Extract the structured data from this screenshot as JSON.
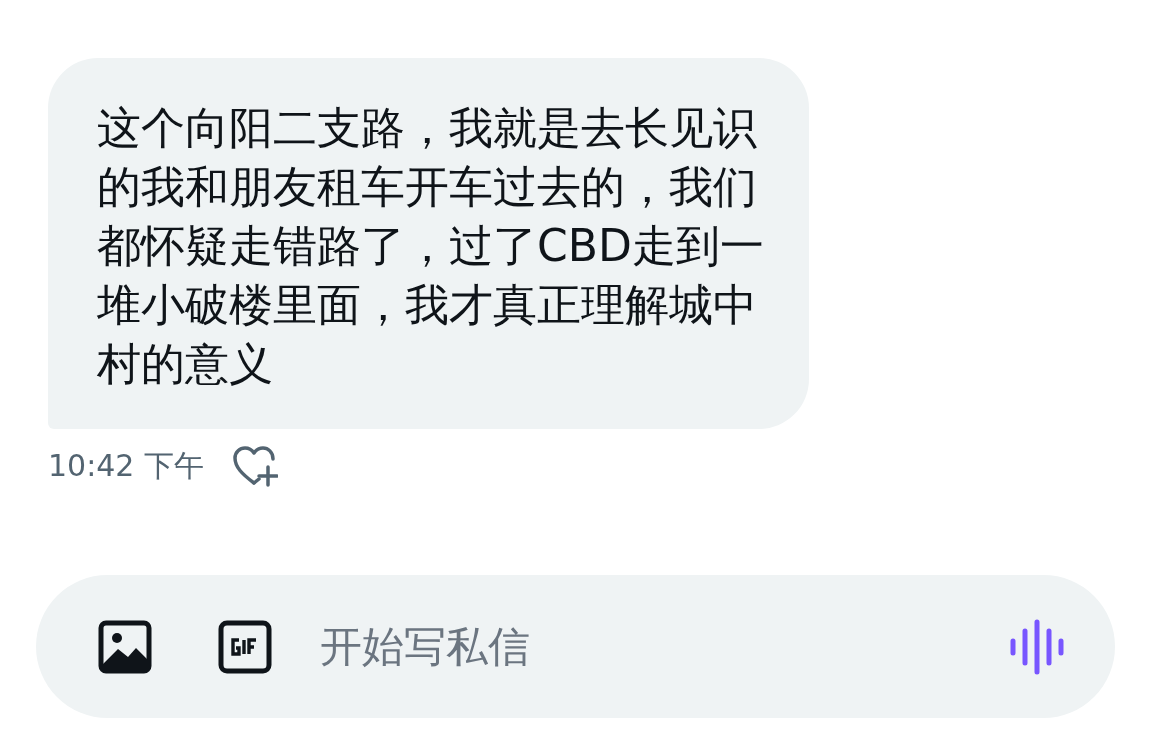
{
  "message": {
    "text": "这个向阳二支路，我就是去长见识的我和朋友租车开车过去的，我们都怀疑走错路了，过了CBD走到一堆小破楼里面，我才真正理解城中村的意义",
    "time": "10:42 下午"
  },
  "composer": {
    "placeholder": "开始写私信"
  }
}
